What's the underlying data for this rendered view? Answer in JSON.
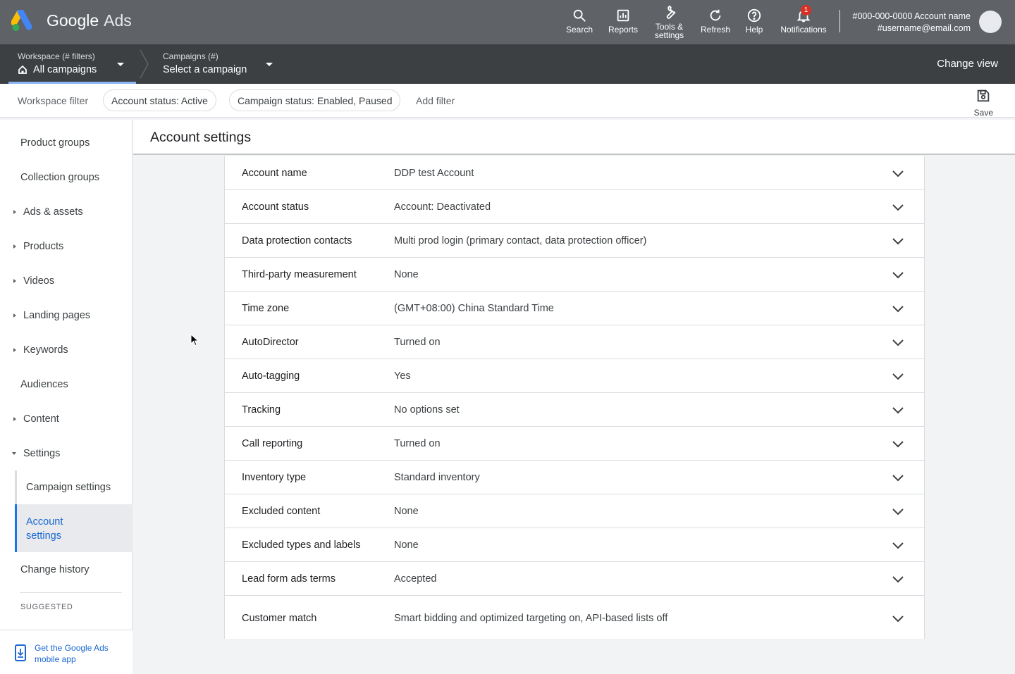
{
  "header": {
    "brand_primary": "Google",
    "brand_secondary": "Ads",
    "tools": [
      {
        "label": "Search",
        "icon": "search-icon"
      },
      {
        "label": "Reports",
        "icon": "reports-icon"
      },
      {
        "label": "Tools &\nsettings",
        "icon": "wrench-icon"
      },
      {
        "label": "Refresh",
        "icon": "refresh-icon"
      },
      {
        "label": "Help",
        "icon": "help-icon"
      },
      {
        "label": "Notifications",
        "icon": "bell-icon",
        "badge": "1"
      }
    ],
    "account_id": "#000-000-0000 Account name",
    "account_email": "#username@email.com"
  },
  "crumbs": {
    "workspace_label": "Workspace (# filters)",
    "workspace_value": "All campaigns",
    "campaigns_label": "Campaigns (#)",
    "campaigns_value": "Select a campaign",
    "change_view": "Change view"
  },
  "filters": {
    "title": "Workspace filter",
    "chips": [
      "Account status: Active",
      "Campaign status: Enabled, Paused"
    ],
    "add": "Add filter",
    "save": "Save"
  },
  "sidebar": {
    "items": [
      {
        "label": "Product groups",
        "expandable": false
      },
      {
        "label": "Collection groups",
        "expandable": false
      },
      {
        "label": "Ads & assets",
        "expandable": true
      },
      {
        "label": "Products",
        "expandable": true
      },
      {
        "label": "Videos",
        "expandable": true
      },
      {
        "label": "Landing pages",
        "expandable": true
      },
      {
        "label": "Keywords",
        "expandable": true
      },
      {
        "label": "Audiences",
        "expandable": false
      },
      {
        "label": "Content",
        "expandable": true
      },
      {
        "label": "Settings",
        "expandable": true,
        "expanded": true
      }
    ],
    "sub_items": [
      "Campaign settings",
      "Account\nsettings"
    ],
    "change_history": "Change history",
    "suggested": "SUGGESTED",
    "app_promo": "Get the Google Ads mobile app"
  },
  "main": {
    "title": "Account settings",
    "rows": [
      {
        "label": "Account name",
        "value": "DDP test Account"
      },
      {
        "label": "Account status",
        "value": "Account: Deactivated"
      },
      {
        "label": "Data protection contacts",
        "value": "Multi prod login (primary contact, data protection officer)"
      },
      {
        "label": "Third-party measurement",
        "value": "None"
      },
      {
        "label": "Time zone",
        "value": "(GMT+08:00) China Standard Time"
      },
      {
        "label": "AutoDirector",
        "value": "Turned on"
      },
      {
        "label": "Auto-tagging",
        "value": "Yes"
      },
      {
        "label": "Tracking",
        "value": "No options set"
      },
      {
        "label": "Call reporting",
        "value": "Turned on"
      },
      {
        "label": "Inventory type",
        "value": "Standard inventory"
      },
      {
        "label": "Excluded content",
        "value": "None"
      },
      {
        "label": "Excluded types and labels",
        "value": "None"
      },
      {
        "label": "Lead form ads terms",
        "value": "Accepted"
      },
      {
        "label": "Customer match",
        "value": "Smart bidding and optimized targeting on, API-based lists off"
      }
    ]
  },
  "colors": {
    "topbar": "#5f6368",
    "crumbbar": "#3c4043",
    "accent": "#1a73e8",
    "badge": "#d93025"
  }
}
